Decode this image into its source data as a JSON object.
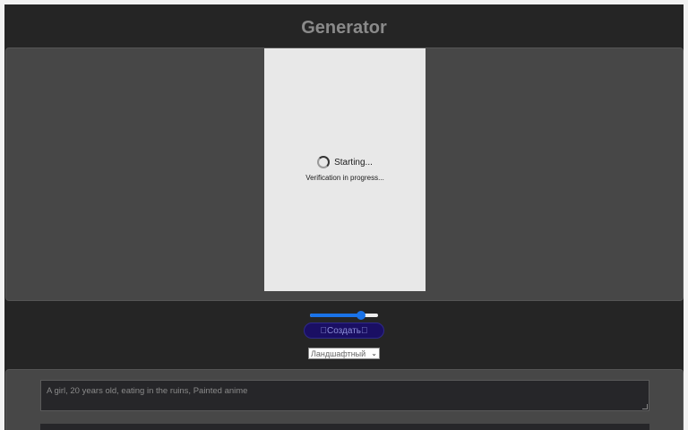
{
  "header": {
    "title": "Generator"
  },
  "captcha": {
    "status": "Starting...",
    "subtext": "Verification in progress..."
  },
  "controls": {
    "slider_value_fraction": 0.75,
    "create_label": "\u0000Создать\u0000",
    "aspect_select": {
      "selected": "Ландшафтный"
    }
  },
  "prompt": {
    "placeholder": "A girl, 20 years old, eating in the ruins, Painted anime"
  },
  "colors": {
    "app_bg": "#252525",
    "panel_bg": "#474747",
    "accent": "#1a73e8",
    "button_bg": "#1a0f63"
  },
  "icons": {
    "spinner": "loading-spinner-icon",
    "dropdown": "chevron-down-icon"
  }
}
